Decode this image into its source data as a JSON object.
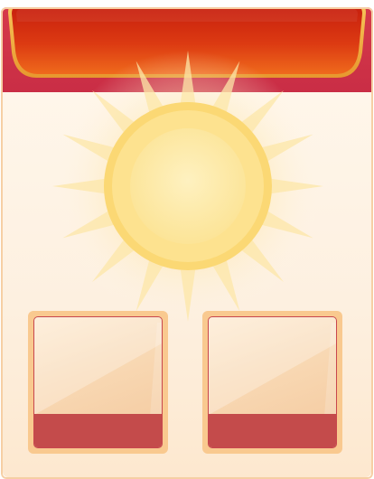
{
  "banner": {
    "title": ""
  },
  "emblem": {
    "icon": "sun-icon"
  },
  "slots": [
    {
      "label": ""
    },
    {
      "label": ""
    }
  ],
  "colors": {
    "banner_red": "#c71f0e",
    "banner_gold_rim": "#f2b64a",
    "header_band": "#d63a4a",
    "panel_fill": "#fff6ea",
    "sun_core": "#fde9a6",
    "sun_ring": "#fbd66e",
    "slot_frame": "#f9c98f",
    "slot_bar": "#c44b4b"
  }
}
